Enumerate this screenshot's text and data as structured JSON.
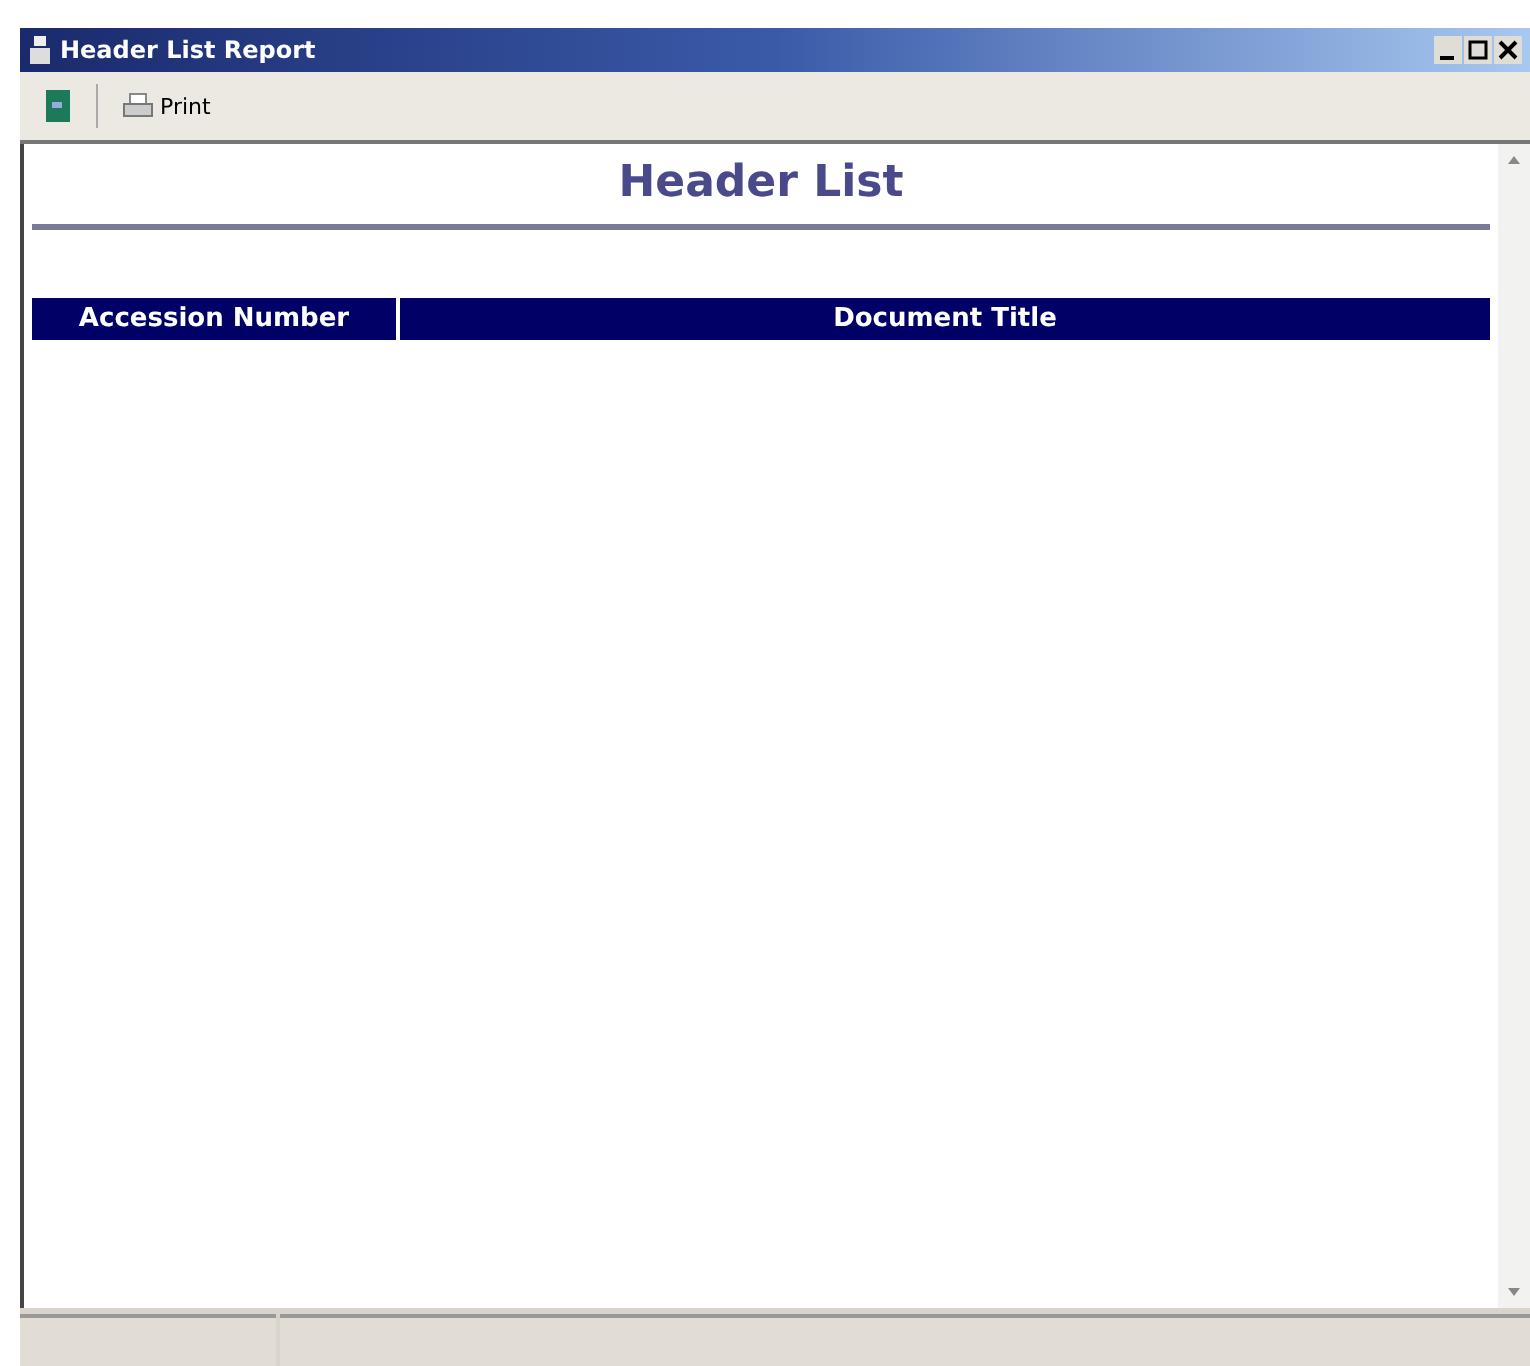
{
  "window": {
    "title": "Header List Report"
  },
  "toolbar": {
    "buttons": [
      {
        "kind": "icon"
      },
      {
        "kind": "print",
        "label": "Print"
      }
    ]
  },
  "report": {
    "title": "Header List",
    "table": {
      "columns": [
        "Accession Number",
        "Document Title"
      ]
    }
  }
}
